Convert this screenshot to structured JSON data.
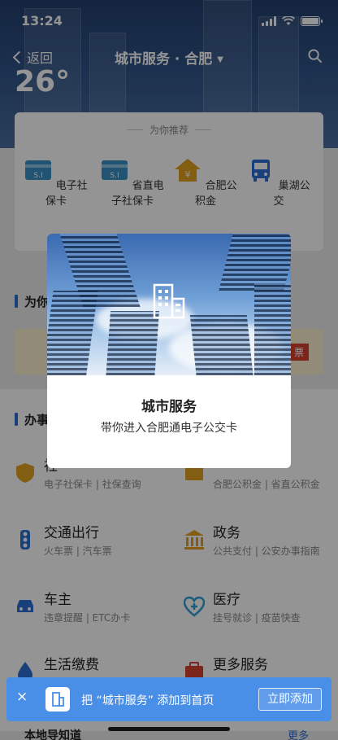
{
  "status": {
    "time": "13:24"
  },
  "nav": {
    "back_label": "返回",
    "title": "城市服务 · 合肥",
    "caret": "▼"
  },
  "weather": {
    "temperature": "26°"
  },
  "recommend": {
    "title": "为你推荐",
    "items": [
      {
        "label": "电子社保卡",
        "icon": "social-security-card-icon"
      },
      {
        "label": "省直电子社保卡",
        "icon": "social-security-card-icon"
      },
      {
        "label": "合肥公积金",
        "icon": "housing-fund-icon"
      },
      {
        "label": "巢湖公交",
        "icon": "bus-icon"
      }
    ]
  },
  "sections": {
    "for_you": "为你",
    "banner_tag": "票",
    "handle": "办事"
  },
  "services": [
    {
      "name": "社",
      "sub": "电子社保卡 | 社保查询",
      "icon": "social-badge-icon",
      "color": "#e0a020"
    },
    {
      "name": "",
      "sub": "合肥公积金 | 省直公积金",
      "icon": "fund-icon",
      "color": "#e0a020"
    },
    {
      "name": "交通出行",
      "sub": "火车票 | 汽车票",
      "icon": "traffic-light-icon",
      "color": "#2d6fd6"
    },
    {
      "name": "政务",
      "sub": "公共支付 | 公安办事指南",
      "icon": "government-icon",
      "color": "#e0a020"
    },
    {
      "name": "车主",
      "sub": "违章提醒 | ETC办卡",
      "icon": "car-icon",
      "color": "#2d6fd6"
    },
    {
      "name": "医疗",
      "sub": "挂号就诊 | 疫苗快查",
      "icon": "medical-icon",
      "color": "#2d9fd6"
    },
    {
      "name": "生活缴费",
      "sub": "",
      "icon": "utility-icon",
      "color": "#2d6fd6"
    },
    {
      "name": "更多服务",
      "sub": "",
      "icon": "more-services-icon",
      "color": "#d6402d"
    }
  ],
  "footer": {
    "local": "本地导知道",
    "more": "更多"
  },
  "modal": {
    "title": "城市服务",
    "desc": "带你进入合肥通电子公交卡"
  },
  "toast": {
    "close": "×",
    "message": "把 “城市服务” 添加到首页",
    "button": "立即添加"
  }
}
